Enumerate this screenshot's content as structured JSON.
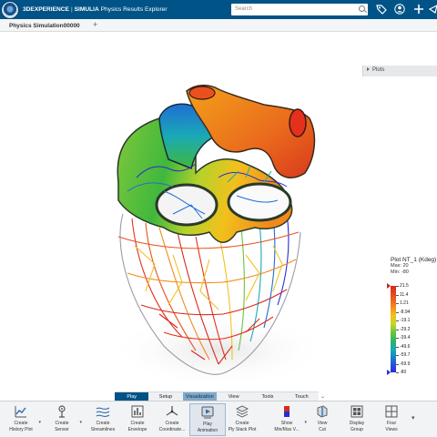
{
  "header": {
    "brand_3d": "3DEXPERIENCE",
    "brand_sep": "|",
    "brand_simulia": "SIMULIA",
    "app_name": "Physics Results Explorer",
    "search_placeholder": "Search"
  },
  "tabs": [
    {
      "label": "Physics Simulation00000"
    }
  ],
  "plots_panel": {
    "label": "Plots"
  },
  "legend": {
    "title": "Plot NT_1 (Kdeg)",
    "max_label": "Max: 20",
    "min_label": "Min: -80",
    "ticks": [
      "21.5",
      "11.4",
      "1.21",
      "-8.94",
      "-19.1",
      "-29.2",
      "-39.4",
      "-49.6",
      "-59.7",
      "-69.9",
      "-80"
    ]
  },
  "modes": {
    "items": [
      "Play",
      "Setup",
      "Visualization",
      "View",
      "Tools",
      "Touch"
    ],
    "active": "Play"
  },
  "actions": [
    {
      "label1": "Create",
      "label2": "History Plot",
      "icon": "history-plot-icon"
    },
    {
      "label1": "Create",
      "label2": "Sensor",
      "icon": "sensor-icon"
    },
    {
      "label1": "Create",
      "label2": "Streamlines",
      "icon": "streamlines-icon"
    },
    {
      "label1": "Create",
      "label2": "Envelope",
      "icon": "envelope-icon"
    },
    {
      "label1": "Create",
      "label2": "Coordinate...",
      "icon": "coordinate-icon"
    },
    {
      "label1": "Play",
      "label2": "Animation",
      "icon": "play-animation-icon"
    },
    {
      "label1": "Create",
      "label2": "Ply Stack Plot",
      "icon": "ply-stack-icon"
    },
    {
      "label1": "Show",
      "label2": "Min/Max V...",
      "icon": "min-max-icon"
    },
    {
      "label1": "View",
      "label2": "Cut",
      "icon": "view-cut-icon"
    },
    {
      "label1": "Display",
      "label2": "Group",
      "icon": "display-group-icon"
    },
    {
      "label1": "Four",
      "label2": "Views",
      "icon": "four-views-icon"
    }
  ],
  "colors": {
    "header_bg": "#005386",
    "accent": "#005386"
  }
}
